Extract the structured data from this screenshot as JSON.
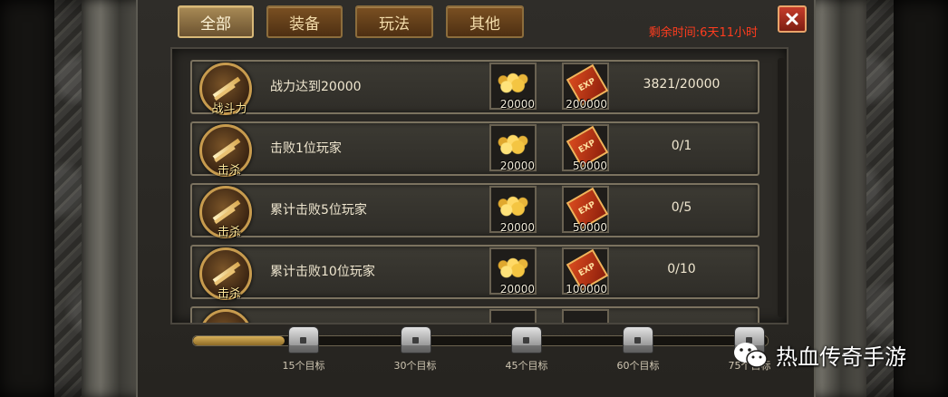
{
  "tabs": [
    {
      "label": "全部",
      "active": true
    },
    {
      "label": "装备",
      "active": false
    },
    {
      "label": "玩法",
      "active": false
    },
    {
      "label": "其他",
      "active": false
    }
  ],
  "timer": "剩余时间:6天11小时",
  "close_icon": "close-x-icon",
  "tasks": [
    {
      "icon_label": "战斗力",
      "name": "战力达到20000",
      "gold": "20000",
      "exp": "200000",
      "progress": "3821/20000",
      "exp_card": "EXP"
    },
    {
      "icon_label": "击杀",
      "name": "击败1位玩家",
      "gold": "20000",
      "exp": "50000",
      "progress": "0/1",
      "exp_card": "EXP"
    },
    {
      "icon_label": "击杀",
      "name": "累计击败5位玩家",
      "gold": "20000",
      "exp": "50000",
      "progress": "0/5",
      "exp_card": "EXP"
    },
    {
      "icon_label": "击杀",
      "name": "累计击败10位玩家",
      "gold": "20000",
      "exp": "100000",
      "progress": "0/10",
      "exp_card": "EXP"
    }
  ],
  "milestones": [
    {
      "label": "15个目标"
    },
    {
      "label": "30个目标"
    },
    {
      "label": "45个目标"
    },
    {
      "label": "60个目标"
    },
    {
      "label": "75个目标"
    }
  ],
  "milestone_progress_fraction": 0.16,
  "watermark": "热血传奇手游",
  "colors": {
    "timer": "#ff3c1e",
    "tab_active": "#a88a55",
    "tab_inactive": "#7a5022"
  }
}
